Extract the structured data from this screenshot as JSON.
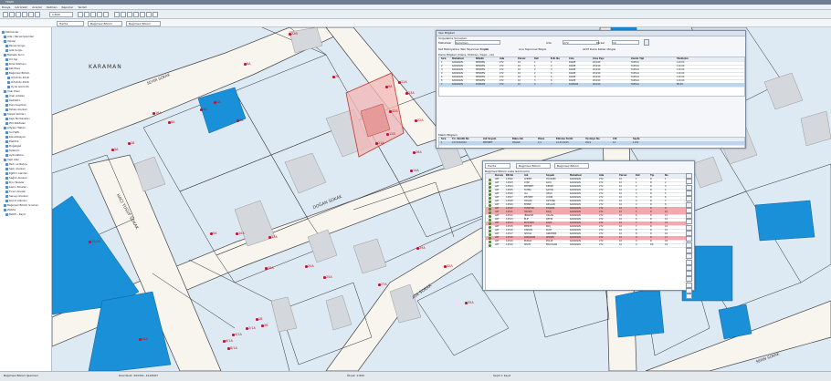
{
  "window": {
    "title": "TKGM"
  },
  "menu": [
    "Dosya",
    "Görünüm",
    "Araçlar",
    "Katman",
    "Raporlar",
    "Yardım"
  ],
  "toolbar": {
    "zoom_value": "1:800"
  },
  "filters": {
    "combo1": "Harita",
    "combo2": "Bağımsız Bölüm",
    "combo3": "Bağımsız Bölüm"
  },
  "tree": {
    "items": [
      "Katmanlar",
      "Ada / Parsel İşlemleri",
      "Yapılar",
      "Parsel Sorgu",
      "Ada Sorgu",
      "Mahalle Sınırı",
      "Yol Ağı",
      "Bina Katmanı",
      "Kat Planı",
      "Bağımsız Bölüm",
      "Ortofoto 2018",
      "Ortofoto 2020",
      "Uydu Görüntü",
      "İmar Planı",
      "İmar Adaları",
      "Kadastro",
      "Tapu Kayıtları",
      "Tahsis Alanları",
      "Sokak İsimleri",
      "Kapı Numaraları",
      "POI Noktaları",
      "Altyapı Hatları",
      "Su Hattı",
      "Kanalizasyon",
      "Elektrik",
      "Doğalgaz",
      "Telekom",
      "Aydınlatma",
      "Yeşil Alan",
      "Park ve Bahçe",
      "Spor Alanları",
      "Eğitim Alanları",
      "Sağlık Alanları",
      "Dini Tesisler",
      "Kamu Binaları",
      "Ticari Alanlar",
      "Sanayi Alanları",
      "Konut Alanları",
      "Bağımsız Bölüm Sınırları",
      "Zabıta",
      "MAKS - Kayıt"
    ]
  },
  "map": {
    "district_label": "KARAMAN",
    "street_labels": [
      "SEHIR SOKAK",
      "DOĞAN SOKAK",
      "HACI YUSUF SOKAK",
      "ATA SOKAK",
      "SERIN SOKAK"
    ],
    "parcel_labels": [
      "22B",
      "1A",
      "4A",
      "6A",
      "8A",
      "2A",
      "12B",
      "21A",
      "16A",
      "3A",
      "18",
      "7B",
      "9A",
      "11A",
      "13A",
      "22A",
      "33A",
      "26A",
      "12/2A",
      "14A",
      "5A",
      "10A",
      "17A",
      "19A",
      "20A",
      "25A",
      "27A",
      "29A",
      "32A",
      "35A",
      "2/1A",
      "4/1A",
      "6/1A",
      "8/1A",
      "1B",
      "2B",
      "24A"
    ]
  },
  "dialog1": {
    "title": "Yapı Bilgileri",
    "subtitle": "Sorgulama Sonuçları",
    "fields": {
      "mahalle_label": "Mahallesi",
      "mahalle_value": "Karaman",
      "ada_label": "Ada",
      "ada_value": "272",
      "parsel_label": "Parsel",
      "parsel_value": "10"
    },
    "section1_label": "Kat Mülkiyetine Tabi Taşınmaz Bilgisi",
    "section1_value": "-16",
    "section2_label": "Ana Taşınmaz Bilgisi",
    "section3_label": "Aktif Daire Katları Bilgisi",
    "grid1_title": "Daire Bilgileri (Daire, Dükkan, Depo...vb)",
    "grid1_headers": [
      "Sıra",
      "Mahallesi",
      "Nitelik",
      "Ada",
      "Parsel",
      "Kat",
      "B.B. No",
      "Cins",
      "Arsa Payı",
      "Zemin Tipi",
      "Yüzölçüm"
    ],
    "grid1_rows": [
      [
        "1",
        "KARAMAN",
        "MESKEN",
        "272",
        "10",
        "1",
        "1",
        "DAİRE",
        "20/240",
        "TAPULU",
        "110.00"
      ],
      [
        "2",
        "KARAMAN",
        "MESKEN",
        "272",
        "10",
        "1",
        "2",
        "DAİRE",
        "20/240",
        "TAPULU",
        "110.00"
      ],
      [
        "3",
        "KARAMAN",
        "MESKEN",
        "272",
        "10",
        "2",
        "3",
        "DAİRE",
        "20/240",
        "TAPULU",
        "110.00"
      ],
      [
        "4",
        "KARAMAN",
        "MESKEN",
        "272",
        "10",
        "2",
        "4",
        "DAİRE",
        "20/240",
        "TAPULU",
        "110.00"
      ],
      [
        "5",
        "KARAMAN",
        "MESKEN",
        "272",
        "10",
        "3",
        "5",
        "DAİRE",
        "20/240",
        "TAPULU",
        "110.00"
      ],
      [
        "6",
        "KARAMAN",
        "MESKEN",
        "272",
        "10",
        "3",
        "6",
        "DAİRE",
        "20/240",
        "TAPULU",
        "110.00"
      ],
      [
        "7",
        "KARAMAN",
        "DÜKKAN",
        "272",
        "10",
        "0",
        "7",
        "DÜKKAN",
        "40/240",
        "TAPULU",
        "85.00"
      ]
    ],
    "grid2_title": "Maliki Bilgileri",
    "grid2_headers": [
      "Sıra",
      "T.C. Kimlik No",
      "Adı Soyadı",
      "Baba Adı",
      "Hisse",
      "Edinme Tarihi",
      "Yevmiye No",
      "Cilt",
      "Sayfa"
    ],
    "grid2_row": [
      "1",
      "1572XXXXXX",
      "MEHMET",
      "HASAN",
      "1/1",
      "12.03.2015",
      "4521",
      "12",
      "1134"
    ]
  },
  "dialog2": {
    "title": "Bağımsız Bölüm Liste Görünümü",
    "tabs": {
      "t1": "Harita",
      "t2": "Bağımsız Bölüm",
      "t3": "Bağımsız Bölüm"
    },
    "headers": [
      "",
      "Durum",
      "BB No",
      "Adı",
      "Soyadı",
      "Mahallesi",
      "Ada",
      "Parsel",
      "Kat",
      "Tip",
      "No"
    ],
    "rows": [
      [
        "",
        "AKT",
        "14502",
        "AHMET",
        "YILDIRIM",
        "KARAMAN",
        "272",
        "10",
        "1",
        "D",
        "1"
      ],
      [
        "",
        "AKT",
        "14503",
        "AYŞE",
        "KAYA",
        "KARAMAN",
        "272",
        "10",
        "1",
        "D",
        "2"
      ],
      [
        "",
        "AKT",
        "14504",
        "MEHMET",
        "DEMİR",
        "KARAMAN",
        "272",
        "10",
        "2",
        "D",
        "3"
      ],
      [
        "",
        "AKT",
        "14505",
        "FATMA",
        "ŞAHİN",
        "KARAMAN",
        "272",
        "10",
        "2",
        "D",
        "4"
      ],
      [
        "",
        "AKT",
        "14506",
        "ALİ",
        "ÇELİK",
        "KARAMAN",
        "272",
        "10",
        "3",
        "D",
        "5"
      ],
      [
        "",
        "AKT",
        "14507",
        "ZEYNEP",
        "AYDIN",
        "KARAMAN",
        "272",
        "10",
        "3",
        "D",
        "6"
      ],
      [
        "",
        "AKT",
        "14508",
        "HASAN",
        "ÖZTÜRK",
        "KARAMAN",
        "272",
        "10",
        "4",
        "D",
        "7"
      ],
      [
        "",
        "AKT",
        "14509",
        "EMİNE",
        "ARSLAN",
        "KARAMAN",
        "272",
        "10",
        "4",
        "D",
        "8"
      ],
      [
        "",
        "AKT",
        "14510",
        "HÜSEYİN",
        "DOĞAN",
        "KARAMAN",
        "272",
        "10",
        "5",
        "D",
        "9"
      ],
      [
        "",
        "AKT",
        "14511",
        "HATİCE",
        "KILIÇ",
        "KARAMAN",
        "272",
        "10",
        "5",
        "D",
        "10"
      ],
      [
        "",
        "AKT",
        "14512",
        "İBRAHİM",
        "ASLAN",
        "KARAMAN",
        "272",
        "10",
        "6",
        "D",
        "11"
      ],
      [
        "",
        "AKT",
        "14513",
        "ELİF",
        "ÇETİN",
        "KARAMAN",
        "272",
        "10",
        "6",
        "D",
        "12"
      ],
      [
        "",
        "AKT",
        "14514",
        "MUSTAFA",
        "KARA",
        "KARAMAN",
        "272",
        "10",
        "7",
        "D",
        "13"
      ],
      [
        "",
        "AKT",
        "14515",
        "MERVE",
        "KOÇ",
        "KARAMAN",
        "272",
        "10",
        "7",
        "D",
        "14"
      ],
      [
        "",
        "AKT",
        "14516",
        "OSMAN",
        "KURT",
        "KARAMAN",
        "272",
        "10",
        "8",
        "D",
        "15"
      ],
      [
        "",
        "AKT",
        "14517",
        "SEVDA",
        "ÖZDEMİR",
        "KARAMAN",
        "272",
        "10",
        "8",
        "D",
        "16"
      ],
      [
        "",
        "AKT",
        "14518",
        "RAMAZAN",
        "ŞİMŞEK",
        "KARAMAN",
        "272",
        "10",
        "9",
        "D",
        "17"
      ],
      [
        "",
        "AKT",
        "14519",
        "BURAK",
        "POLAT",
        "KARAMAN",
        "272",
        "10",
        "9",
        "D",
        "18"
      ],
      [
        "",
        "AKT",
        "14520",
        "SELİM",
        "ERDOĞAN",
        "KARAMAN",
        "272",
        "10",
        "0",
        "DK",
        "19"
      ]
    ]
  },
  "status": {
    "left": "Bağımsız Bölüm İşlemleri",
    "mid": "Koordinat: 452301, 4124567",
    "center": "Ölçek: 1:800",
    "right": "Seçili 1 kayıt"
  },
  "colors": {
    "building_blue": "#1a90d9",
    "parcel_line": "#2b2b2b",
    "label_red": "#b3141a",
    "highlight_pink": "#f1a9ad",
    "map_bg": "#dde9f3"
  }
}
